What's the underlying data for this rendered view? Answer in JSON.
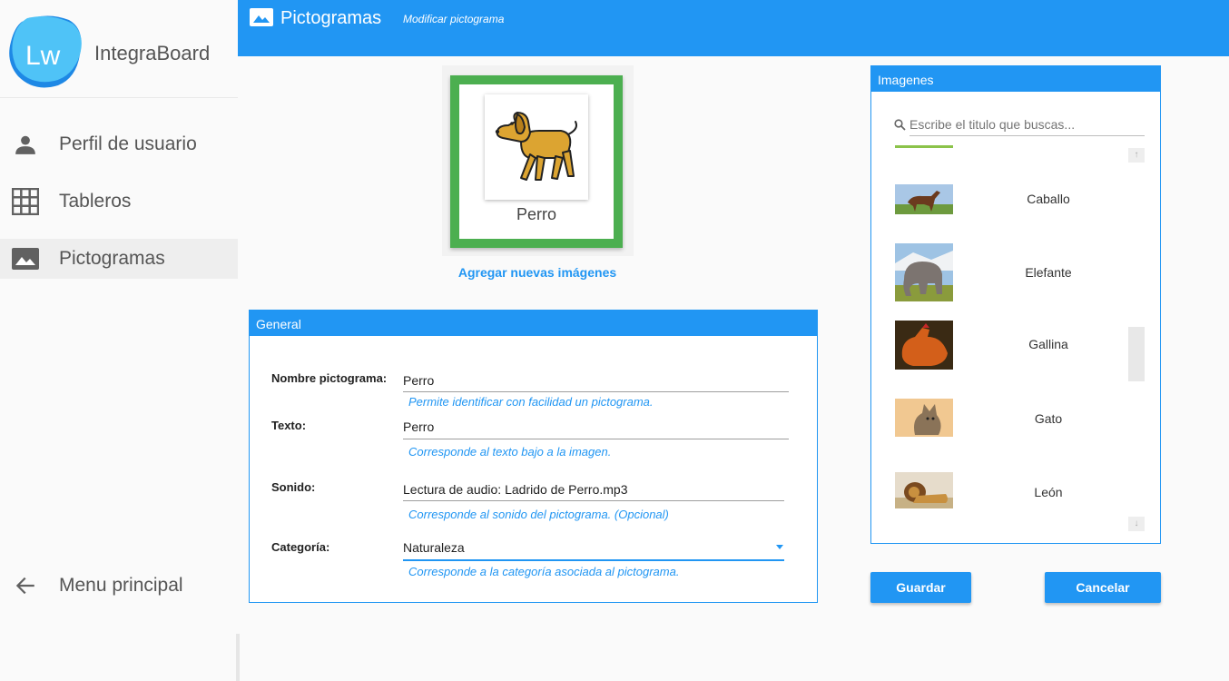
{
  "brand": {
    "name": "IntegraBoard",
    "logo_text": "Lw"
  },
  "sidebar": {
    "items": [
      {
        "label": "Perfil de usuario",
        "icon": "person-icon"
      },
      {
        "label": "Tableros",
        "icon": "grid-icon"
      },
      {
        "label": "Pictogramas",
        "icon": "image-icon"
      }
    ],
    "back": {
      "label": "Menu principal",
      "icon": "arrow-back-icon"
    }
  },
  "header": {
    "title": "Pictogramas",
    "subtitle": "Modificar pictograma",
    "icon": "image-icon"
  },
  "preview": {
    "label": "Perro",
    "add_images": "Agregar nuevas imágenes",
    "frame_color": "#4caf50"
  },
  "general": {
    "title": "General",
    "fields": [
      {
        "label": "Nombre pictograma:",
        "value": "Perro",
        "hint": "Permite identificar con facilidad un pictograma."
      },
      {
        "label": "Texto:",
        "value": "Perro",
        "hint": "Corresponde al texto bajo a la imagen."
      },
      {
        "label": "Sonido:",
        "value": "Lectura de audio: Ladrido de Perro.mp3",
        "hint": "Corresponde al sonido del pictograma. (Opcional)"
      },
      {
        "label": "Categoría:",
        "value": "Naturaleza",
        "hint": "Corresponde a la categoría asociada al pictograma."
      }
    ]
  },
  "images": {
    "title": "Imagenes",
    "search_placeholder": "Escribe el titulo que buscas...",
    "items": [
      {
        "label": "Caballo"
      },
      {
        "label": "Elefante"
      },
      {
        "label": "Gallina"
      },
      {
        "label": "Gato"
      },
      {
        "label": "León"
      }
    ]
  },
  "actions": {
    "save": "Guardar",
    "cancel": "Cancelar"
  },
  "colors": {
    "primary": "#2196f3",
    "accent_green": "#4caf50"
  }
}
